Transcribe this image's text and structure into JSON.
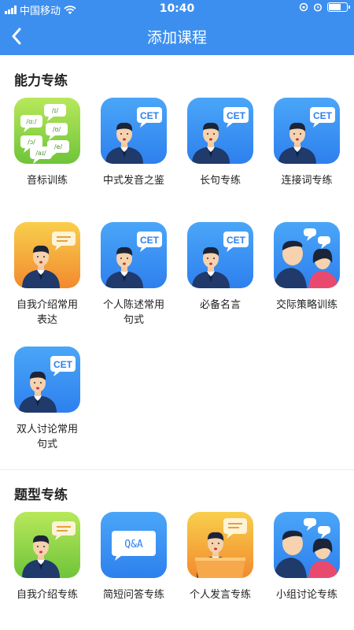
{
  "status_bar": {
    "carrier": "中国移动",
    "time": "10:40"
  },
  "nav": {
    "title": "添加课程"
  },
  "sections": [
    {
      "title": "能力专练",
      "items": [
        {
          "label_lines": [
            "音标训练"
          ],
          "icon": "phonetic-bubbles-icon",
          "color": "green"
        },
        {
          "label_lines": [
            "中式发音之鉴"
          ],
          "icon": "cet-speaker-icon",
          "color": "blue",
          "badge": "CET"
        },
        {
          "label_lines": [
            "长句专练"
          ],
          "icon": "cet-speaker-icon",
          "color": "blue",
          "badge": "CET"
        },
        {
          "label_lines": [
            "连接词专练"
          ],
          "icon": "cet-speaker-icon",
          "color": "blue",
          "badge": "CET"
        },
        {
          "label_lines": [
            "自我介绍常用",
            "表达"
          ],
          "icon": "speaker-bubble-icon",
          "color": "orange"
        },
        {
          "label_lines": [
            "个人陈述常用",
            "句式"
          ],
          "icon": "cet-speaker-icon",
          "color": "blue",
          "badge": "CET"
        },
        {
          "label_lines": [
            "必备名言"
          ],
          "icon": "cet-speaker-icon",
          "color": "blue",
          "badge": "CET"
        },
        {
          "label_lines": [
            "交际策略训练"
          ],
          "icon": "two-people-chat-icon",
          "color": "blue"
        },
        {
          "label_lines": [
            "双人讨论常用",
            "句式"
          ],
          "icon": "cet-speaker-icon",
          "color": "blue",
          "badge": "CET"
        }
      ]
    },
    {
      "title": "题型专练",
      "items": [
        {
          "label_lines": [
            "自我介绍专练"
          ],
          "icon": "speaker-bubble-icon",
          "color": "green"
        },
        {
          "label_lines": [
            "简短问答专练"
          ],
          "icon": "qa-bubble-icon",
          "color": "blue",
          "badge": "Q&A"
        },
        {
          "label_lines": [
            "个人发言专练"
          ],
          "icon": "podium-speaker-icon",
          "color": "orange"
        },
        {
          "label_lines": [
            "小组讨论专练"
          ],
          "icon": "two-people-chat-icon",
          "color": "blue"
        }
      ]
    }
  ]
}
